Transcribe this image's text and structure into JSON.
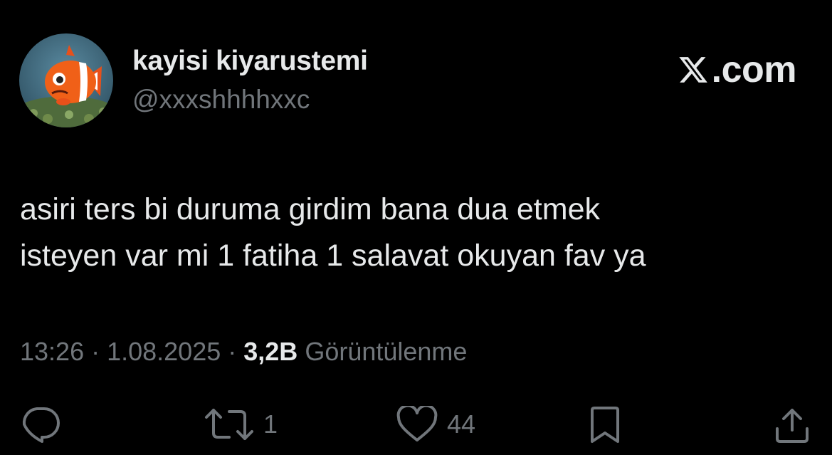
{
  "author": {
    "display_name": "kayisi kiyarustemi",
    "handle": "@xxxshhhhxxc",
    "avatar_icon": "clownfish-avatar"
  },
  "brand": {
    "label": ".com",
    "logo_icon": "x-logo-icon"
  },
  "tweet": {
    "lines": [
      "asiri ters bi duruma girdim bana dua etmek",
      "isteyen var mi 1 fatiha 1 salavat okuyan fav ya"
    ]
  },
  "meta": {
    "time": "13:26",
    "separator": " · ",
    "date": "1.08.2025",
    "views_count": "3,2B",
    "views_label": "Görüntülenme"
  },
  "actions": {
    "reply": {
      "icon": "reply-icon",
      "count": ""
    },
    "repost": {
      "icon": "repost-icon",
      "count": "1"
    },
    "like": {
      "icon": "heart-icon",
      "count": "44"
    },
    "bookmark": {
      "icon": "bookmark-icon"
    },
    "share": {
      "icon": "share-icon"
    }
  },
  "colors": {
    "background": "#000000",
    "text_primary": "#e7e9ea",
    "text_secondary": "#71767b"
  }
}
